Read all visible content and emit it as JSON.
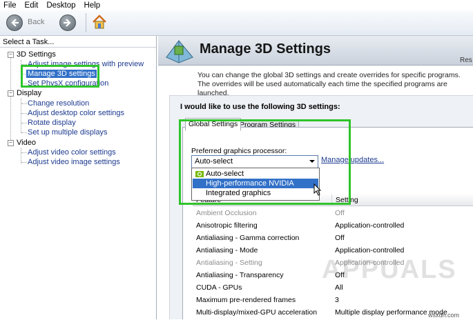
{
  "menu": {
    "items": [
      "File",
      "Edit",
      "Desktop",
      "Help"
    ]
  },
  "toolbar": {
    "back_label": "Back",
    "back_icon": "arrow-left-icon",
    "forward_icon": "arrow-right-icon",
    "home_icon": "home-icon"
  },
  "sidebar": {
    "header": "Select a Task...",
    "categories": [
      {
        "label": "3D Settings",
        "items": [
          "Adjust image settings with preview",
          "Manage 3D settings",
          "Set PhysX configuration"
        ]
      },
      {
        "label": "Display",
        "items": [
          "Change resolution",
          "Adjust desktop color settings",
          "Rotate display",
          "Set up multiple displays"
        ]
      },
      {
        "label": "Video",
        "items": [
          "Adjust video color settings",
          "Adjust video image settings"
        ]
      }
    ],
    "selected": "Manage 3D settings"
  },
  "main": {
    "title": "Manage 3D Settings",
    "restore_label": "Res",
    "description": "You can change the global 3D settings and create overrides for specific programs. The overrides will be used automatically each time the specified programs are launched.",
    "panel_title": "I would like to use the following 3D settings:",
    "tabs": [
      "Global Settings",
      "Program Settings"
    ],
    "active_tab": "Global Settings",
    "preferred_label": "Preferred graphics processor:",
    "preferred_value": "Auto-select",
    "manage_updates": "Manage updates...",
    "dropdown_options": [
      "Auto-select",
      "High-performance NVIDIA processor",
      "Integrated graphics"
    ],
    "highlighted_option": "High-performance NVIDIA processor",
    "table": {
      "headers": [
        "Feature",
        "Setting"
      ],
      "rows": [
        {
          "feature": "Ambient Occlusion",
          "setting": "Off",
          "disabled": true
        },
        {
          "feature": "Anisotropic filtering",
          "setting": "Application-controlled",
          "disabled": false
        },
        {
          "feature": "Antialiasing - Gamma correction",
          "setting": "Off",
          "disabled": false
        },
        {
          "feature": "Antialiasing - Mode",
          "setting": "Application-controlled",
          "disabled": false
        },
        {
          "feature": "Antialiasing - Setting",
          "setting": "Application-controlled",
          "disabled": true
        },
        {
          "feature": "Antialiasing - Transparency",
          "setting": "Off",
          "disabled": false
        },
        {
          "feature": "CUDA - GPUs",
          "setting": "All",
          "disabled": false
        },
        {
          "feature": "Maximum pre-rendered frames",
          "setting": "3",
          "disabled": false
        },
        {
          "feature": "Multi-display/mixed-GPU acceleration",
          "setting": "Multiple display performance mode",
          "disabled": false
        }
      ]
    }
  },
  "watermark": {
    "brand": "APPUALS",
    "site": "wsxdn.com"
  },
  "colors": {
    "highlight_green": "#2fc42a",
    "selection_blue": "#3271c8",
    "link_blue": "#1c3a8f"
  }
}
